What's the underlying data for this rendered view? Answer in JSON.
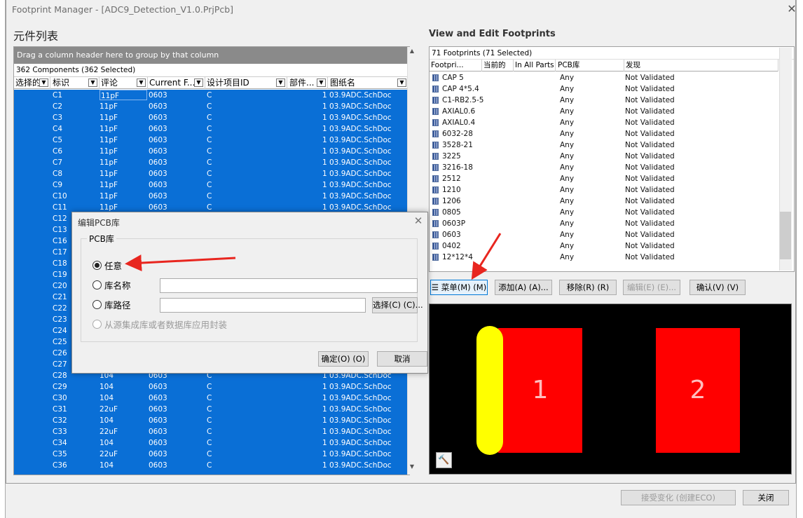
{
  "window": {
    "title": "Footprint Manager - [ADC9_Detection_V1.0.PrjPcb]",
    "close_glyph": "✕"
  },
  "left_panel": {
    "title": "元件列表",
    "group_hint": "Drag a column header here to group by that column",
    "count_text": "362 Components (362 Selected)",
    "columns": [
      "选择的",
      "标识",
      "评论",
      "Current F...",
      "设计项目ID",
      "部件...",
      "图纸名"
    ],
    "rows": [
      {
        "des": "C1",
        "comment": "11pF",
        "fp": "0603",
        "id": "C",
        "part": "1",
        "sheet": "03.9ADC.SchDoc"
      },
      {
        "des": "C2",
        "comment": "11pF",
        "fp": "0603",
        "id": "C",
        "part": "1",
        "sheet": "03.9ADC.SchDoc"
      },
      {
        "des": "C3",
        "comment": "11pF",
        "fp": "0603",
        "id": "C",
        "part": "1",
        "sheet": "03.9ADC.SchDoc"
      },
      {
        "des": "C4",
        "comment": "11pF",
        "fp": "0603",
        "id": "C",
        "part": "1",
        "sheet": "03.9ADC.SchDoc"
      },
      {
        "des": "C5",
        "comment": "11pF",
        "fp": "0603",
        "id": "C",
        "part": "1",
        "sheet": "03.9ADC.SchDoc"
      },
      {
        "des": "C6",
        "comment": "11pF",
        "fp": "0603",
        "id": "C",
        "part": "1",
        "sheet": "03.9ADC.SchDoc"
      },
      {
        "des": "C7",
        "comment": "11pF",
        "fp": "0603",
        "id": "C",
        "part": "1",
        "sheet": "03.9ADC.SchDoc"
      },
      {
        "des": "C8",
        "comment": "11pF",
        "fp": "0603",
        "id": "C",
        "part": "1",
        "sheet": "03.9ADC.SchDoc"
      },
      {
        "des": "C9",
        "comment": "11pF",
        "fp": "0603",
        "id": "C",
        "part": "1",
        "sheet": "03.9ADC.SchDoc"
      },
      {
        "des": "C10",
        "comment": "11pF",
        "fp": "0603",
        "id": "C",
        "part": "1",
        "sheet": "03.9ADC.SchDoc"
      },
      {
        "des": "C11",
        "comment": "11pF",
        "fp": "0603",
        "id": "C",
        "part": "1",
        "sheet": "03.9ADC.SchDoc"
      },
      {
        "des": "C12",
        "comment": "",
        "fp": "",
        "id": "",
        "part": "",
        "sheet": ""
      },
      {
        "des": "C13",
        "comment": "",
        "fp": "",
        "id": "",
        "part": "",
        "sheet": ""
      },
      {
        "des": "C16",
        "comment": "",
        "fp": "",
        "id": "",
        "part": "",
        "sheet": ""
      },
      {
        "des": "C17",
        "comment": "",
        "fp": "",
        "id": "",
        "part": "",
        "sheet": ""
      },
      {
        "des": "C18",
        "comment": "",
        "fp": "",
        "id": "",
        "part": "",
        "sheet": ""
      },
      {
        "des": "C19",
        "comment": "",
        "fp": "",
        "id": "",
        "part": "",
        "sheet": ""
      },
      {
        "des": "C20",
        "comment": "",
        "fp": "",
        "id": "",
        "part": "",
        "sheet": ""
      },
      {
        "des": "C21",
        "comment": "",
        "fp": "",
        "id": "",
        "part": "",
        "sheet": ""
      },
      {
        "des": "C22",
        "comment": "",
        "fp": "",
        "id": "",
        "part": "",
        "sheet": ""
      },
      {
        "des": "C23",
        "comment": "",
        "fp": "",
        "id": "",
        "part": "",
        "sheet": ""
      },
      {
        "des": "C24",
        "comment": "",
        "fp": "",
        "id": "",
        "part": "",
        "sheet": ""
      },
      {
        "des": "C25",
        "comment": "",
        "fp": "",
        "id": "",
        "part": "",
        "sheet": ""
      },
      {
        "des": "C26",
        "comment": "",
        "fp": "",
        "id": "",
        "part": "",
        "sheet": ""
      },
      {
        "des": "C27",
        "comment": "",
        "fp": "",
        "id": "",
        "part": "",
        "sheet": ""
      },
      {
        "des": "C28",
        "comment": "104",
        "fp": "0603",
        "id": "C",
        "part": "1",
        "sheet": "03.9ADC.SchDoc"
      },
      {
        "des": "C29",
        "comment": "104",
        "fp": "0603",
        "id": "C",
        "part": "1",
        "sheet": "03.9ADC.SchDoc"
      },
      {
        "des": "C30",
        "comment": "104",
        "fp": "0603",
        "id": "C",
        "part": "1",
        "sheet": "03.9ADC.SchDoc"
      },
      {
        "des": "C31",
        "comment": "22uF",
        "fp": "0603",
        "id": "C",
        "part": "1",
        "sheet": "03.9ADC.SchDoc"
      },
      {
        "des": "C32",
        "comment": "104",
        "fp": "0603",
        "id": "C",
        "part": "1",
        "sheet": "03.9ADC.SchDoc"
      },
      {
        "des": "C33",
        "comment": "22uF",
        "fp": "0603",
        "id": "C",
        "part": "1",
        "sheet": "03.9ADC.SchDoc"
      },
      {
        "des": "C34",
        "comment": "104",
        "fp": "0603",
        "id": "C",
        "part": "1",
        "sheet": "03.9ADC.SchDoc"
      },
      {
        "des": "C35",
        "comment": "22uF",
        "fp": "0603",
        "id": "C",
        "part": "1",
        "sheet": "03.9ADC.SchDoc"
      },
      {
        "des": "C36",
        "comment": "104",
        "fp": "0603",
        "id": "C",
        "part": "1",
        "sheet": "03.9ADC.SchDoc"
      }
    ]
  },
  "right_panel": {
    "title": "View and Edit Footprints",
    "count_text": "71 Footprints (71 Selected)",
    "columns": [
      "Footpri...",
      "当前的",
      "In All Parts",
      "PCB库",
      "发现"
    ],
    "rows": [
      {
        "name": "CAP 5",
        "lib": "Any",
        "status": "Not Validated"
      },
      {
        "name": "CAP 4*5.4",
        "lib": "Any",
        "status": "Not Validated"
      },
      {
        "name": "C1-RB2.5-5",
        "lib": "Any",
        "status": "Not Validated"
      },
      {
        "name": "AXIAL0.6",
        "lib": "Any",
        "status": "Not Validated"
      },
      {
        "name": "AXIAL0.4",
        "lib": "Any",
        "status": "Not Validated"
      },
      {
        "name": "6032-28",
        "lib": "Any",
        "status": "Not Validated"
      },
      {
        "name": "3528-21",
        "lib": "Any",
        "status": "Not Validated"
      },
      {
        "name": "3225",
        "lib": "Any",
        "status": "Not Validated"
      },
      {
        "name": "3216-18",
        "lib": "Any",
        "status": "Not Validated"
      },
      {
        "name": "2512",
        "lib": "Any",
        "status": "Not Validated"
      },
      {
        "name": "1210",
        "lib": "Any",
        "status": "Not Validated"
      },
      {
        "name": "1206",
        "lib": "Any",
        "status": "Not Validated"
      },
      {
        "name": "0805",
        "lib": "Any",
        "status": "Not Validated"
      },
      {
        "name": "0603P",
        "lib": "Any",
        "status": "Not Validated"
      },
      {
        "name": "0603",
        "lib": "Any",
        "status": "Not Validated"
      },
      {
        "name": "0402",
        "lib": "Any",
        "status": "Not Validated"
      },
      {
        "name": "12*12*4",
        "lib": "Any",
        "status": "Not Validated"
      }
    ],
    "buttons": {
      "menu": "菜单(M) (M)",
      "add": "添加(A) (A)...",
      "remove": "移除(R) (R)",
      "edit": "编辑(E) (E)...",
      "confirm": "确认(V) (V)"
    },
    "preview": {
      "pad1": "1",
      "pad2": "2"
    }
  },
  "footer": {
    "accept": "接受变化 (创建ECO)",
    "close": "关闭"
  },
  "dialog": {
    "title": "编辑PCB库",
    "group_label": "PCB库",
    "opt_any": "任意",
    "opt_libname": "库名称",
    "opt_libpath": "库路径",
    "browse": "选择(C) (C)...",
    "opt_integrated": "从源集成库或者数据库应用封装",
    "ok": "确定(O) (O)",
    "cancel": "取消"
  },
  "colors": {
    "selection": "#0a6fd6",
    "pad": "#ff0000",
    "pad_pin1": "#ffff00",
    "arrow": "#e8261f"
  }
}
